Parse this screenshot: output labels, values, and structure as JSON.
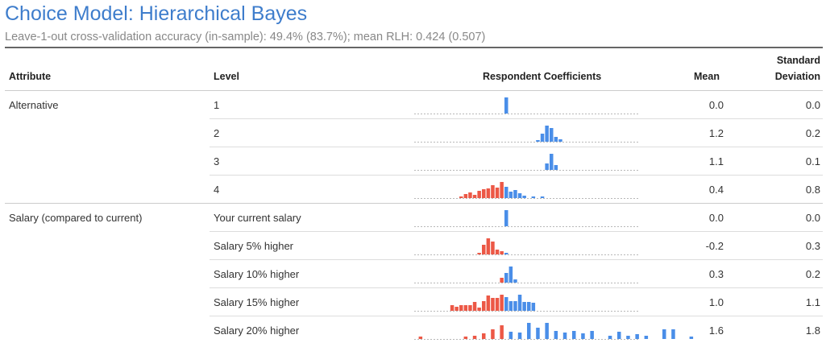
{
  "title": "Choice Model: Hierarchical Bayes",
  "subtitle": "Leave-1-out cross-validation accuracy (in-sample): 49.4% (83.7%); mean RLH: 0.424 (0.507)",
  "headers": {
    "attribute": "Attribute",
    "level": "Level",
    "coefficients": "Respondent Coefficients",
    "mean": "Mean",
    "sd_line1": "Standard",
    "sd_line2": "Deviation"
  },
  "colors": {
    "positive": "#4a8ee8",
    "negative": "#ec5846",
    "title": "#3e7dcc"
  },
  "rows": [
    {
      "attribute": "Alternative",
      "level": "1",
      "mean": "0.0",
      "sd": "0.0",
      "hist_start": 0.0,
      "hist_step": 0.2,
      "hist": [
        20
      ]
    },
    {
      "attribute": "",
      "level": "2",
      "mean": "1.2",
      "sd": "0.2",
      "hist_start": 0.7,
      "hist_step": 0.1,
      "hist": [
        2,
        10,
        20,
        17,
        6,
        3
      ]
    },
    {
      "attribute": "",
      "level": "3",
      "mean": "1.1",
      "sd": "0.1",
      "hist_start": 0.9,
      "hist_step": 0.1,
      "hist": [
        8,
        20,
        6
      ]
    },
    {
      "attribute": "",
      "level": "4",
      "mean": "0.4",
      "sd": "0.8",
      "hist_start": -1.0,
      "hist_step": 0.1,
      "hist": [
        2,
        5,
        7,
        4,
        9,
        11,
        12,
        16,
        13,
        20,
        14,
        8,
        10,
        6,
        3,
        0,
        2,
        0,
        2
      ]
    },
    {
      "attribute": "Salary (compared to current)",
      "level": "Your current salary",
      "mean": "0.0",
      "sd": "0.0",
      "hist_start": 0.0,
      "hist_step": 0.2,
      "hist": [
        20
      ]
    },
    {
      "attribute": "",
      "level": "Salary 5% higher",
      "mean": "-0.2",
      "sd": "0.3",
      "hist_start": -0.6,
      "hist_step": 0.1,
      "hist": [
        2,
        12,
        20,
        16,
        6,
        4,
        2
      ]
    },
    {
      "attribute": "",
      "level": "Salary 10% higher",
      "mean": "0.3",
      "sd": "0.2",
      "hist_start": -0.1,
      "hist_step": 0.1,
      "hist": [
        6,
        12,
        20,
        4
      ]
    },
    {
      "attribute": "",
      "level": "Salary 15% higher",
      "mean": "1.0",
      "sd": "1.1",
      "hist_start": -1.2,
      "hist_step": 0.1,
      "hist": [
        7,
        5,
        7,
        7,
        7,
        11,
        4,
        12,
        19,
        16,
        16,
        20,
        17,
        12,
        12,
        20,
        11,
        11,
        10
      ]
    },
    {
      "attribute": "",
      "level": "Salary 20% higher",
      "mean": "1.6",
      "sd": "1.8",
      "hist_start": -1.9,
      "hist_step": 0.2,
      "hist": [
        3,
        0,
        0,
        0,
        0,
        3,
        4,
        7,
        12,
        17,
        9,
        8,
        20,
        14,
        20,
        10,
        8,
        10,
        7,
        10,
        0,
        4,
        9,
        4,
        6,
        4,
        0,
        12,
        12,
        0,
        3
      ]
    }
  ]
}
